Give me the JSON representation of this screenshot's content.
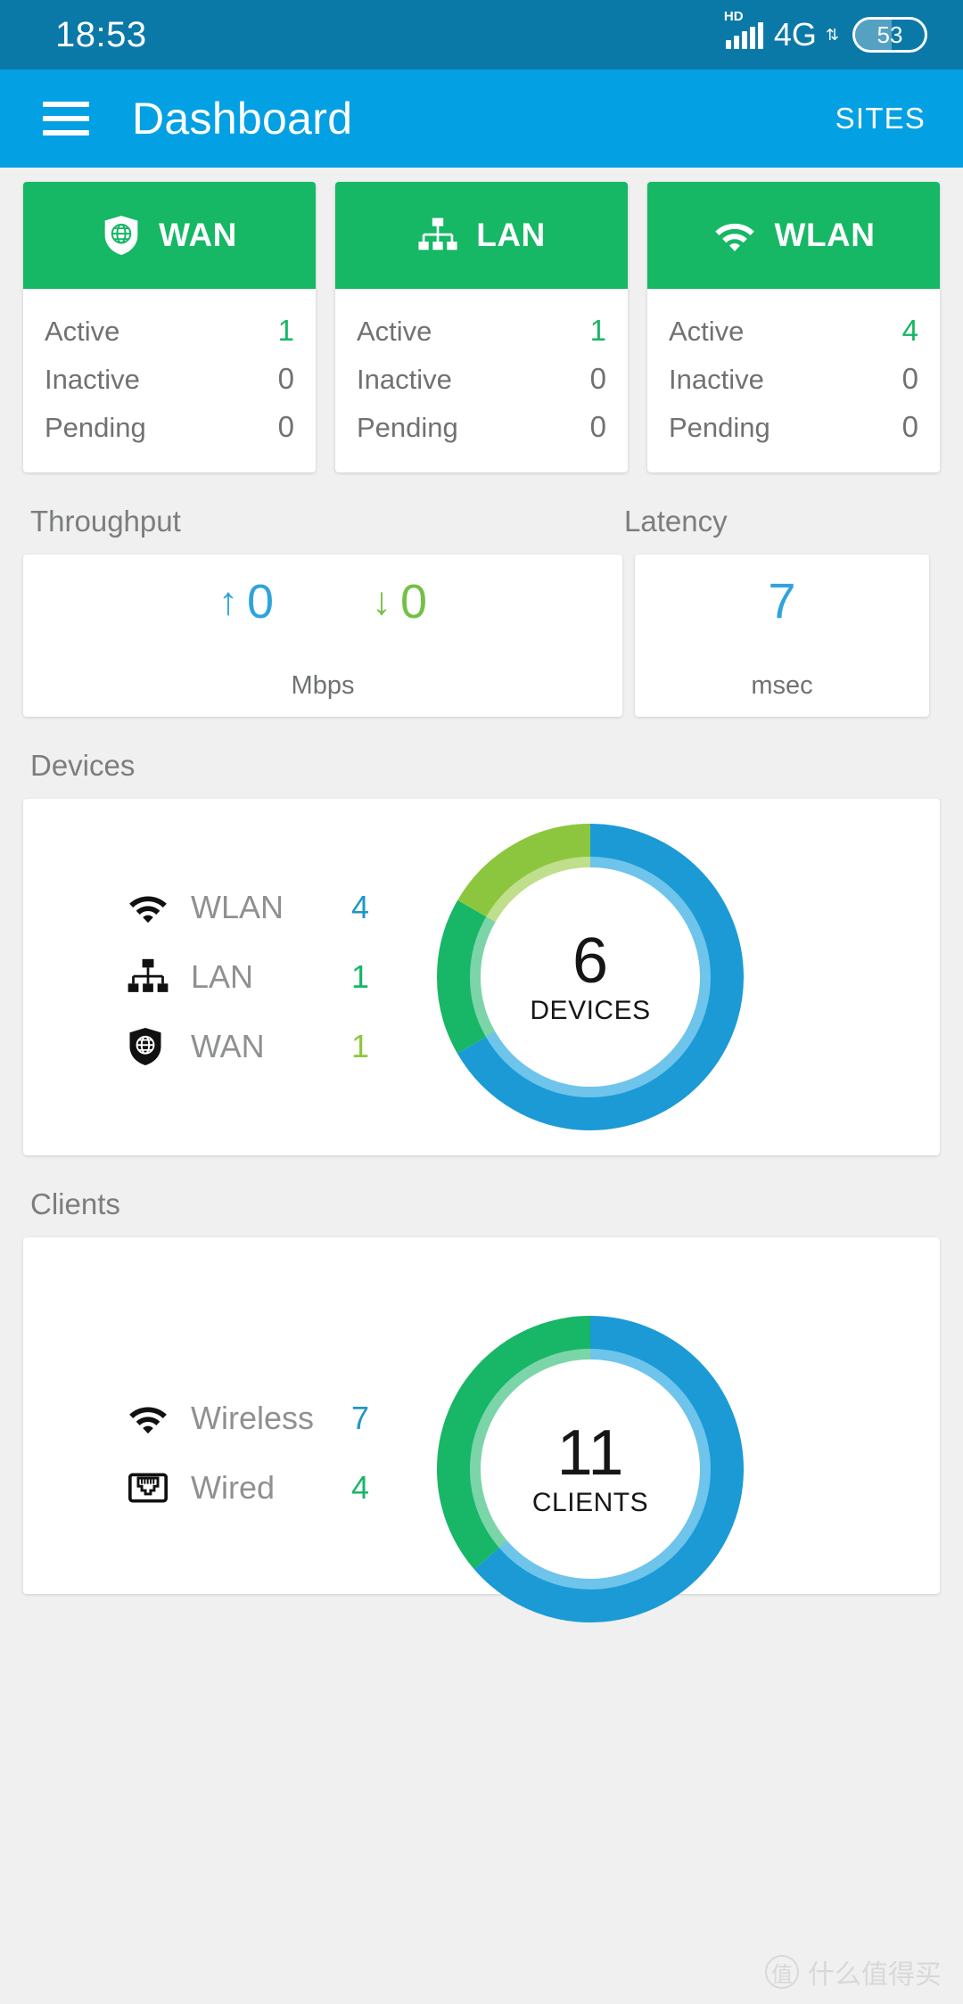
{
  "statusbar": {
    "time": "18:53",
    "hd_label": "HD",
    "network": "4G",
    "data_arrows": "⇅",
    "battery_level": "53"
  },
  "appbar": {
    "menu_icon": "hamburger-icon",
    "title": "Dashboard",
    "action_label": "SITES"
  },
  "status_cards": [
    {
      "title": "WAN",
      "icon": "shield-globe-icon",
      "rows": [
        {
          "label": "Active",
          "value": "1",
          "highlight": true
        },
        {
          "label": "Inactive",
          "value": "0",
          "highlight": false
        },
        {
          "label": "Pending",
          "value": "0",
          "highlight": false
        }
      ]
    },
    {
      "title": "LAN",
      "icon": "network-hierarchy-icon",
      "rows": [
        {
          "label": "Active",
          "value": "1",
          "highlight": true
        },
        {
          "label": "Inactive",
          "value": "0",
          "highlight": false
        },
        {
          "label": "Pending",
          "value": "0",
          "highlight": false
        }
      ]
    },
    {
      "title": "WLAN",
      "icon": "wifi-icon",
      "rows": [
        {
          "label": "Active",
          "value": "4",
          "highlight": true
        },
        {
          "label": "Inactive",
          "value": "0",
          "highlight": false
        },
        {
          "label": "Pending",
          "value": "0",
          "highlight": false
        }
      ]
    }
  ],
  "throughput": {
    "section_label": "Throughput",
    "upload_arrow": "↑",
    "upload_value": "0",
    "download_arrow": "↓",
    "download_value": "0",
    "unit": "Mbps"
  },
  "latency": {
    "section_label": "Latency",
    "value": "7",
    "unit": "msec"
  },
  "devices": {
    "section_label": "Devices",
    "legend": [
      {
        "icon": "wifi-icon",
        "label": "WLAN",
        "value": "4",
        "color": "#2196c8"
      },
      {
        "icon": "network-hierarchy-icon",
        "label": "LAN",
        "value": "1",
        "color": "#18b667"
      },
      {
        "icon": "shield-globe-icon",
        "label": "WAN",
        "value": "1",
        "color": "#8cc63f"
      }
    ],
    "total": "6",
    "caption": "DEVICES"
  },
  "clients": {
    "section_label": "Clients",
    "legend": [
      {
        "icon": "wifi-icon",
        "label": "Wireless",
        "value": "7",
        "color": "#2196c8"
      },
      {
        "icon": "ethernet-port-icon",
        "label": "Wired",
        "value": "4",
        "color": "#18b667"
      }
    ],
    "total": "11",
    "caption": "CLIENTS"
  },
  "watermark": {
    "badge": "值",
    "text": "什么值得买"
  },
  "colors": {
    "statusbar_bg": "#0b79a8",
    "appbar_bg": "#03a0e3",
    "card_header_green": "#16b765",
    "blue": "#1b9ad6",
    "green": "#18b667",
    "lightgreen": "#8cc63f",
    "page_bg": "#f0f0f0"
  },
  "chart_data": [
    {
      "type": "pie",
      "title": "Devices",
      "center_value": 6,
      "center_caption": "DEVICES",
      "categories": [
        "WLAN",
        "LAN",
        "WAN"
      ],
      "values": [
        4,
        1,
        1
      ],
      "colors": [
        "#1b9ad6",
        "#18b667",
        "#8cc63f"
      ],
      "legend_position": "left",
      "donut": true,
      "start_angle_deg": 0,
      "direction": "clockwise"
    },
    {
      "type": "pie",
      "title": "Clients",
      "center_value": 11,
      "center_caption": "CLIENTS",
      "categories": [
        "Wireless",
        "Wired"
      ],
      "values": [
        7,
        4
      ],
      "colors": [
        "#1b9ad6",
        "#18b667"
      ],
      "legend_position": "left",
      "donut": true,
      "start_angle_deg": 0,
      "direction": "clockwise"
    }
  ]
}
